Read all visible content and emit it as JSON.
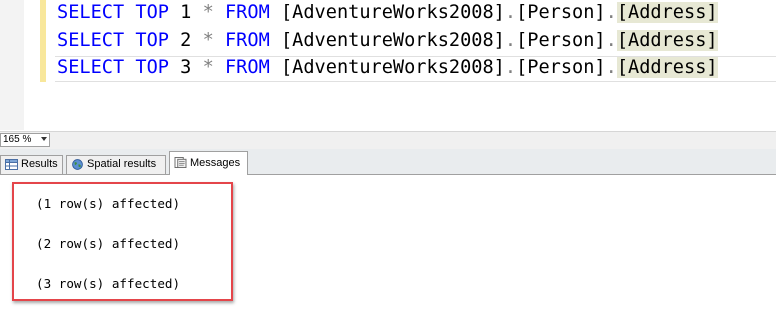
{
  "editor": {
    "lines": [
      {
        "keyword_select": "SELECT",
        "keyword_top": "TOP",
        "count": "1",
        "star": "*",
        "keyword_from": "FROM",
        "db": "[AdventureWorks2008]",
        "dot1": ".",
        "schema": "[Person]",
        "dot2": ".",
        "table": "[Address]"
      },
      {
        "keyword_select": "SELECT",
        "keyword_top": "TOP",
        "count": "2",
        "star": "*",
        "keyword_from": "FROM",
        "db": "[AdventureWorks2008]",
        "dot1": ".",
        "schema": "[Person]",
        "dot2": ".",
        "table": "[Address]"
      },
      {
        "keyword_select": "SELECT",
        "keyword_top": "TOP",
        "count": "3",
        "star": "*",
        "keyword_from": "FROM",
        "db": "[AdventureWorks2008]",
        "dot1": ".",
        "schema": "[Person]",
        "dot2": ".",
        "table": "[Address]"
      }
    ],
    "colors": {
      "keyword": "#0000ff",
      "operator": "#808080",
      "text": "#000000",
      "change_bar": "#f8e79b",
      "highlight": "#e7e8d4"
    }
  },
  "zoom": {
    "value": "165 %"
  },
  "tabs": [
    {
      "label": "Results",
      "icon": "grid-icon",
      "active": false
    },
    {
      "label": "Spatial results",
      "icon": "globe-icon",
      "active": false
    },
    {
      "label": "Messages",
      "icon": "messages-icon",
      "active": true
    }
  ],
  "messages": {
    "lines": [
      "(1 row(s) affected)",
      "(2 row(s) affected)",
      "(3 row(s) affected)"
    ],
    "highlight_color": "#e4454a"
  }
}
